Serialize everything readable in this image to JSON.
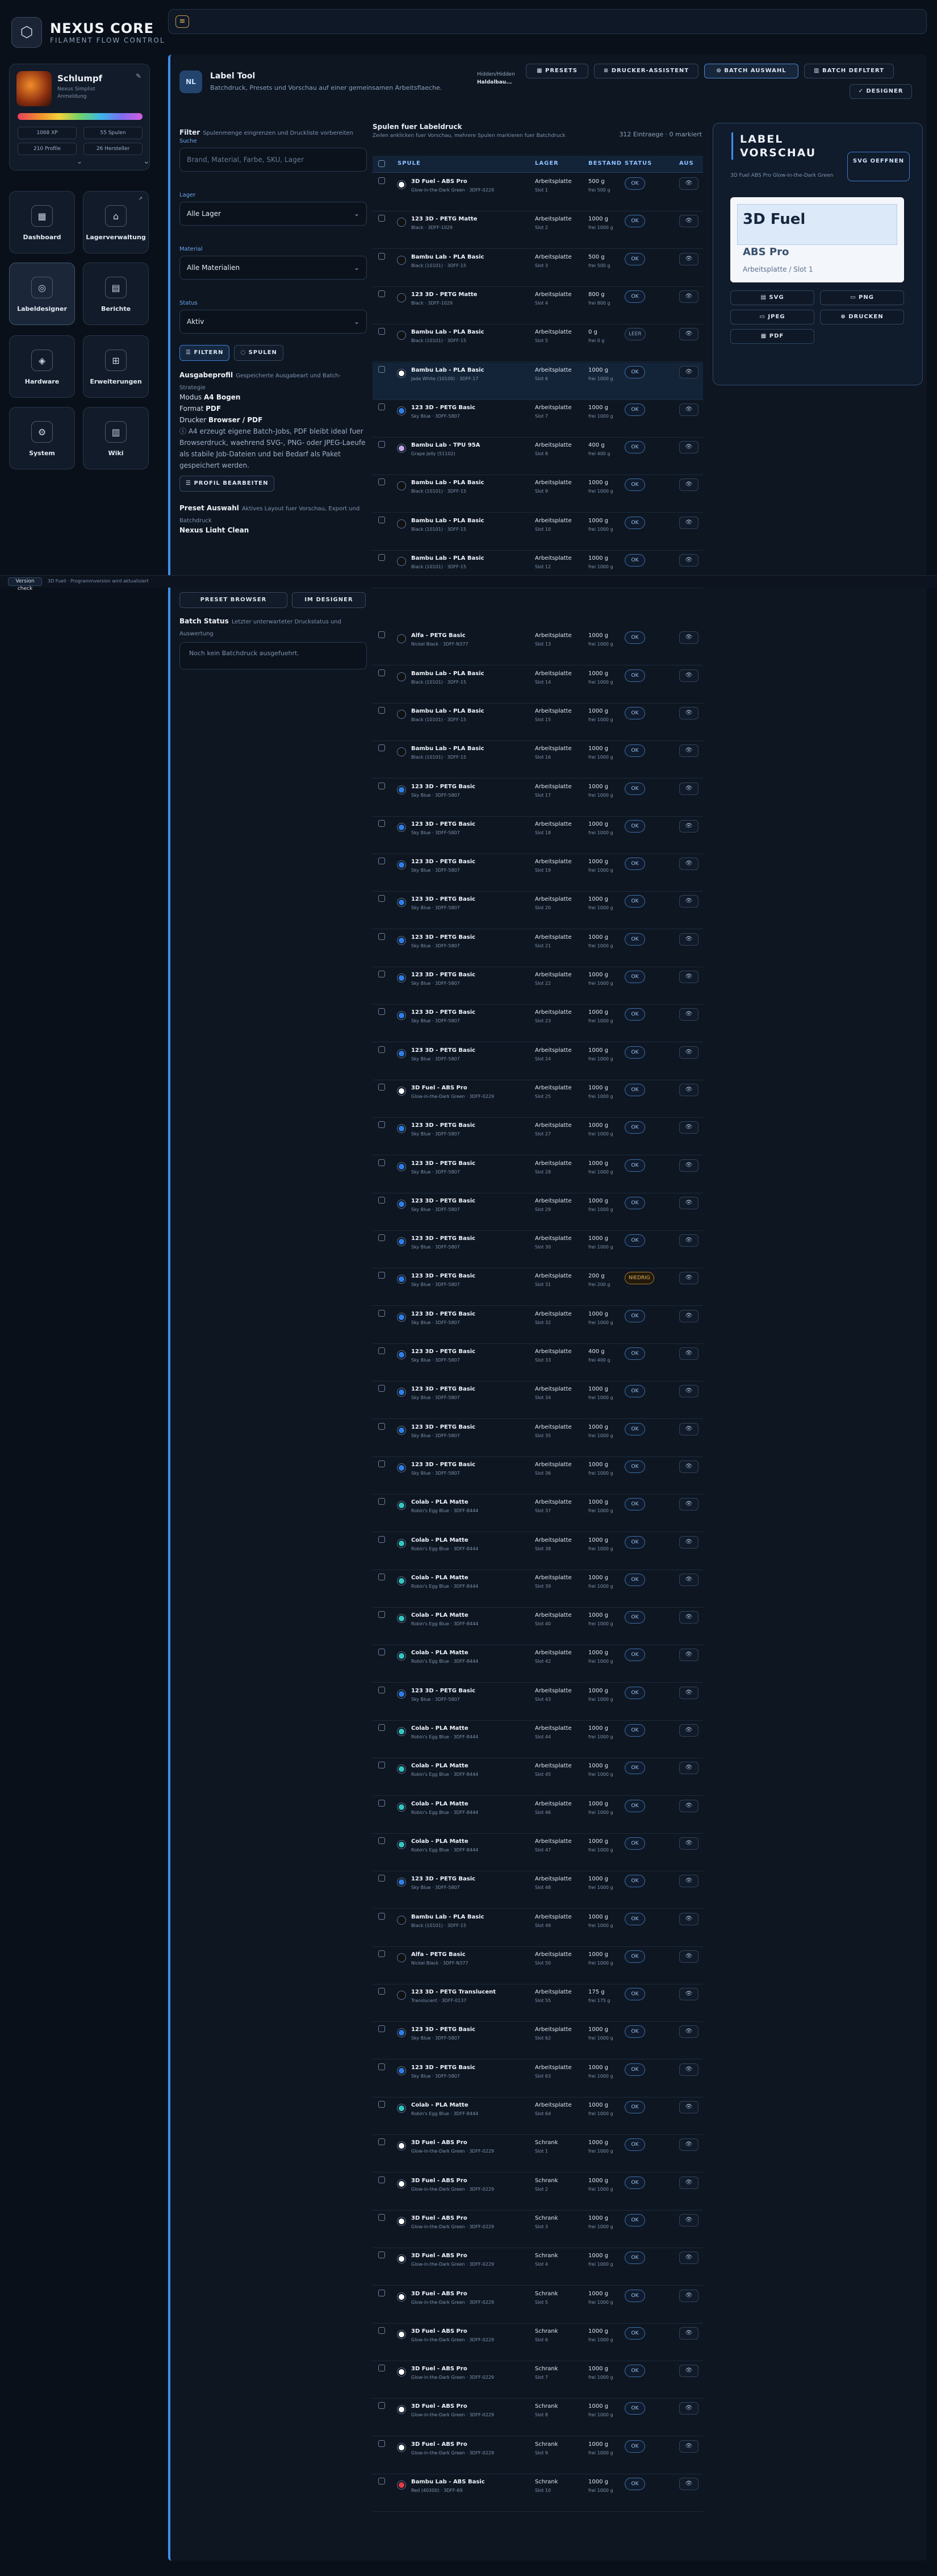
{
  "brand": {
    "title": "NEXUS CORE",
    "subtitle": "FILAMENT FLOW CONTROL"
  },
  "profile": {
    "name": "Schlumpf",
    "line1": "Nexus Simplist",
    "line2": "Anmeldung",
    "stats": [
      "1068 XP",
      "55 Spulen",
      "210 Profile",
      "26 Hersteller"
    ]
  },
  "nav": [
    {
      "label": "Dashboard",
      "icon": "grid-icon"
    },
    {
      "label": "Lagerverwaltung",
      "icon": "warehouse-icon"
    },
    {
      "label": "Labeldesigner",
      "icon": "tag-icon"
    },
    {
      "label": "Berichte",
      "icon": "report-icon"
    },
    {
      "label": "Hardware",
      "icon": "chip-icon"
    },
    {
      "label": "Erweiterungen",
      "icon": "plugin-icon"
    },
    {
      "label": "System",
      "icon": "gear-icon"
    },
    {
      "label": "Wiki",
      "icon": "book-icon"
    }
  ],
  "divider": {
    "button": "Version check",
    "text": "3D Fuell · Programmversion wird aktualisiert"
  },
  "tool": {
    "icon_text": "NL",
    "title": "Label Tool",
    "subtitle": "Batchdruck, Presets und Vorschau auf einer gemeinsamen Arbeitsflaeche.",
    "id_line1": "Hidden/Hidden",
    "id_line2": "Haldalbau..."
  },
  "toolbar": {
    "presets": "PRESETS",
    "printer": "DRUCKER-ASSISTENT",
    "batch": "BATCH AUSWAHL",
    "batch_off": "BATCH DEFLTERT",
    "designer": "DESIGNER"
  },
  "filter": {
    "title": "Filter",
    "desc": "Spulenmenge eingrenzen und Druckliste vorbereiten",
    "search_label": "Suche",
    "search_placeholder": "Brand, Material, Farbe, SKU, Lager",
    "lager_label": "Lager",
    "lager_value": "Alle Lager",
    "material_label": "Material",
    "material_value": "Alle Materialien",
    "status_label": "Status",
    "status_value": "Aktiv",
    "btn_filter": "FILTERN",
    "btn_reset": "SPULEN"
  },
  "output": {
    "title": "Ausgabeprofil",
    "desc": "Gespeicherte Ausgabeart und Batch-Strategie",
    "mode_label": "Modus",
    "mode_value": "A4 Bogen",
    "format_label": "Format",
    "format_value": "PDF",
    "printer_label": "Drucker",
    "printer_value": "Browser / PDF",
    "note": "A4 erzeugt eigene Batch-Jobs, PDF bleibt ideal fuer Browserdruck, waehrend SVG-, PNG- oder JPEG-Laeufe als stabile Job-Dateien und bei Bedarf als Paket gespeichert werden.",
    "edit_btn": "PROFIL BEARBEITEN"
  },
  "preset": {
    "title": "Preset Auswahl",
    "desc": "Aktives Layout fuer Vorschau, Export und Batchdruck",
    "current": "Nexus Light Clean",
    "browser_btn": "PRESET BROWSER",
    "designer_btn": "IM DESIGNER"
  },
  "batch": {
    "title": "Batch Status",
    "desc": "Letzter unterwarteter Druckstatus und Auswertung",
    "empty": "Noch kein Batchdruck ausgefuehrt."
  },
  "table": {
    "title": "Spulen fuer Labeldruck",
    "subtitle": "Zeilen anklicken fuer Vorschau, mehrere Spulen markieren fuer Batchdruck",
    "count": "312 Eintraege · 0 markiert",
    "headers": [
      "SPULE",
      "LAGER",
      "BESTAND",
      "STATUS",
      "AUS"
    ]
  },
  "rows": [
    {
      "name": "3D Fuel - ABS Pro",
      "sub": "Glow-in-the-Dark Green · 3DFF-0229",
      "lager": "Arbeitsplatte",
      "slot": "Slot 1",
      "amount": "500 g",
      "of": "frei 500 g",
      "status": "OK",
      "color": "#ffffff"
    },
    {
      "name": "123 3D - PETG Matte",
      "sub": "Black · 3DFF-1029",
      "lager": "Arbeitsplatte",
      "slot": "Slot 2",
      "amount": "1000 g",
      "of": "frei 1000 g",
      "status": "OK",
      "color": "#111111"
    },
    {
      "name": "Bambu Lab - PLA Basic",
      "sub": "Black (10101) · 3DFF-15",
      "lager": "Arbeitsplatte",
      "slot": "Slot 3",
      "amount": "500 g",
      "of": "frei 500 g",
      "status": "OK",
      "color": "#111111"
    },
    {
      "name": "123 3D - PETG Matte",
      "sub": "Black · 3DFF-1029",
      "lager": "Arbeitsplatte",
      "slot": "Slot 4",
      "amount": "800 g",
      "of": "frei 800 g",
      "status": "OK",
      "color": "#111111"
    },
    {
      "name": "Bambu Lab - PLA Basic",
      "sub": "Black (10101) · 3DFF-15",
      "lager": "Arbeitsplatte",
      "slot": "Slot 5",
      "amount": "0 g",
      "of": "frei 0 g",
      "status": "LEER",
      "color": "#111111"
    },
    {
      "name": "Bambu Lab - PLA Basic",
      "sub": "Jade White (10100) · 3DFF-17",
      "lager": "Arbeitsplatte",
      "slot": "Slot 6",
      "amount": "1000 g",
      "of": "frei 1000 g",
      "status": "OK",
      "color": "#ffffff",
      "selected": true
    },
    {
      "name": "123 3D - PETG Basic",
      "sub": "Sky Blue · 3DFF-5807",
      "lager": "Arbeitsplatte",
      "slot": "Slot 7",
      "amount": "1000 g",
      "of": "frei 1000 g",
      "status": "OK",
      "color": "#2f7fe8"
    },
    {
      "name": "Bambu Lab - TPU 95A",
      "sub": "Grape Jelly (51102)",
      "lager": "Arbeitsplatte",
      "slot": "Slot 8",
      "amount": "400 g",
      "of": "frei 400 g",
      "status": "OK",
      "color": "#c9a8e8"
    },
    {
      "name": "Bambu Lab - PLA Basic",
      "sub": "Black (10101) · 3DFF-15",
      "lager": "Arbeitsplatte",
      "slot": "Slot 9",
      "amount": "1000 g",
      "of": "frei 1000 g",
      "status": "OK",
      "color": "#111111"
    },
    {
      "name": "Bambu Lab - PLA Basic",
      "sub": "Black (10101) · 3DFF-15",
      "lager": "Arbeitsplatte",
      "slot": "Slot 10",
      "amount": "1000 g",
      "of": "frei 1000 g",
      "status": "OK",
      "color": "#111111"
    },
    {
      "name": "Bambu Lab - PLA Basic",
      "sub": "Black (10101) · 3DFF-15",
      "lager": "Arbeitsplatte",
      "slot": "Slot 12",
      "amount": "1000 g",
      "of": "frei 1000 g",
      "status": "OK",
      "color": "#111111"
    },
    {
      "name": "Alfa - PETG Basic",
      "sub": "Nickel Black · 3DFF-N377",
      "lager": "Arbeitsplatte",
      "slot": "Slot 13",
      "amount": "1000 g",
      "of": "frei 1000 g",
      "status": "OK",
      "color": "#111111"
    },
    {
      "name": "Bambu Lab - PLA Basic",
      "sub": "Black (10101) · 3DFF-15",
      "lager": "Arbeitsplatte",
      "slot": "Slot 14",
      "amount": "1000 g",
      "of": "frei 1000 g",
      "status": "OK",
      "color": "#111111"
    },
    {
      "name": "Bambu Lab - PLA Basic",
      "sub": "Black (10101) · 3DFF-15",
      "lager": "Arbeitsplatte",
      "slot": "Slot 15",
      "amount": "1000 g",
      "of": "frei 1000 g",
      "status": "OK",
      "color": "#111111"
    },
    {
      "name": "Bambu Lab - PLA Basic",
      "sub": "Black (10101) · 3DFF-15",
      "lager": "Arbeitsplatte",
      "slot": "Slot 16",
      "amount": "1000 g",
      "of": "frei 1000 g",
      "status": "OK",
      "color": "#111111"
    },
    {
      "name": "123 3D - PETG Basic",
      "sub": "Sky Blue · 3DFF-5807",
      "lager": "Arbeitsplatte",
      "slot": "Slot 17",
      "amount": "1000 g",
      "of": "frei 1000 g",
      "status": "OK",
      "color": "#2f7fe8"
    },
    {
      "name": "123 3D - PETG Basic",
      "sub": "Sky Blue · 3DFF-5807",
      "lager": "Arbeitsplatte",
      "slot": "Slot 18",
      "amount": "1000 g",
      "of": "frei 1000 g",
      "status": "OK",
      "color": "#2f7fe8"
    },
    {
      "name": "123 3D - PETG Basic",
      "sub": "Sky Blue · 3DFF-5807",
      "lager": "Arbeitsplatte",
      "slot": "Slot 19",
      "amount": "1000 g",
      "of": "frei 1000 g",
      "status": "OK",
      "color": "#2f7fe8"
    },
    {
      "name": "123 3D - PETG Basic",
      "sub": "Sky Blue · 3DFF-5807",
      "lager": "Arbeitsplatte",
      "slot": "Slot 20",
      "amount": "1000 g",
      "of": "frei 1000 g",
      "status": "OK",
      "color": "#2f7fe8"
    },
    {
      "name": "123 3D - PETG Basic",
      "sub": "Sky Blue · 3DFF-5807",
      "lager": "Arbeitsplatte",
      "slot": "Slot 21",
      "amount": "1000 g",
      "of": "frei 1000 g",
      "status": "OK",
      "color": "#2f7fe8"
    },
    {
      "name": "123 3D - PETG Basic",
      "sub": "Sky Blue · 3DFF-5807",
      "lager": "Arbeitsplatte",
      "slot": "Slot 22",
      "amount": "1000 g",
      "of": "frei 1000 g",
      "status": "OK",
      "color": "#2f7fe8"
    },
    {
      "name": "123 3D - PETG Basic",
      "sub": "Sky Blue · 3DFF-5807",
      "lager": "Arbeitsplatte",
      "slot": "Slot 23",
      "amount": "1000 g",
      "of": "frei 1000 g",
      "status": "OK",
      "color": "#2f7fe8"
    },
    {
      "name": "123 3D - PETG Basic",
      "sub": "Sky Blue · 3DFF-5807",
      "lager": "Arbeitsplatte",
      "slot": "Slot 24",
      "amount": "1000 g",
      "of": "frei 1000 g",
      "status": "OK",
      "color": "#2f7fe8"
    },
    {
      "name": "3D Fuel - ABS Pro",
      "sub": "Glow-in-the-Dark Green · 3DFF-0229",
      "lager": "Arbeitsplatte",
      "slot": "Slot 25",
      "amount": "1000 g",
      "of": "frei 1000 g",
      "status": "OK",
      "color": "#ffffff"
    },
    {
      "name": "123 3D - PETG Basic",
      "sub": "Sky Blue · 3DFF-5807",
      "lager": "Arbeitsplatte",
      "slot": "Slot 27",
      "amount": "1000 g",
      "of": "frei 1000 g",
      "status": "OK",
      "color": "#2f7fe8"
    },
    {
      "name": "123 3D - PETG Basic",
      "sub": "Sky Blue · 3DFF-5807",
      "lager": "Arbeitsplatte",
      "slot": "Slot 28",
      "amount": "1000 g",
      "of": "frei 1000 g",
      "status": "OK",
      "color": "#2f7fe8"
    },
    {
      "name": "123 3D - PETG Basic",
      "sub": "Sky Blue · 3DFF-5807",
      "lager": "Arbeitsplatte",
      "slot": "Slot 29",
      "amount": "1000 g",
      "of": "frei 1000 g",
      "status": "OK",
      "color": "#2f7fe8"
    },
    {
      "name": "123 3D - PETG Basic",
      "sub": "Sky Blue · 3DFF-5807",
      "lager": "Arbeitsplatte",
      "slot": "Slot 30",
      "amount": "1000 g",
      "of": "frei 1000 g",
      "status": "OK",
      "color": "#2f7fe8"
    },
    {
      "name": "123 3D - PETG Basic",
      "sub": "Sky Blue · 3DFF-5807",
      "lager": "Arbeitsplatte",
      "slot": "Slot 31",
      "amount": "200 g",
      "of": "frei 200 g",
      "status": "NIEDRIG",
      "color": "#2f7fe8"
    },
    {
      "name": "123 3D - PETG Basic",
      "sub": "Sky Blue · 3DFF-5807",
      "lager": "Arbeitsplatte",
      "slot": "Slot 32",
      "amount": "1000 g",
      "of": "frei 1000 g",
      "status": "OK",
      "color": "#2f7fe8"
    },
    {
      "name": "123 3D - PETG Basic",
      "sub": "Sky Blue · 3DFF-5807",
      "lager": "Arbeitsplatte",
      "slot": "Slot 33",
      "amount": "400 g",
      "of": "frei 400 g",
      "status": "OK",
      "color": "#2f7fe8"
    },
    {
      "name": "123 3D - PETG Basic",
      "sub": "Sky Blue · 3DFF-5807",
      "lager": "Arbeitsplatte",
      "slot": "Slot 34",
      "amount": "1000 g",
      "of": "frei 1000 g",
      "status": "OK",
      "color": "#2f7fe8"
    },
    {
      "name": "123 3D - PETG Basic",
      "sub": "Sky Blue · 3DFF-5807",
      "lager": "Arbeitsplatte",
      "slot": "Slot 35",
      "amount": "1000 g",
      "of": "frei 1000 g",
      "status": "OK",
      "color": "#2f7fe8"
    },
    {
      "name": "123 3D - PETG Basic",
      "sub": "Sky Blue · 3DFF-5807",
      "lager": "Arbeitsplatte",
      "slot": "Slot 36",
      "amount": "1000 g",
      "of": "frei 1000 g",
      "status": "OK",
      "color": "#2f7fe8"
    },
    {
      "name": "Colab - PLA Matte",
      "sub": "Robin's Egg Blue · 3DFF-8444",
      "lager": "Arbeitsplatte",
      "slot": "Slot 37",
      "amount": "1000 g",
      "of": "frei 1000 g",
      "status": "OK",
      "color": "#34c7c0"
    },
    {
      "name": "Colab - PLA Matte",
      "sub": "Robin's Egg Blue · 3DFF-8444",
      "lager": "Arbeitsplatte",
      "slot": "Slot 38",
      "amount": "1000 g",
      "of": "frei 1000 g",
      "status": "OK",
      "color": "#34c7c0"
    },
    {
      "name": "Colab - PLA Matte",
      "sub": "Robin's Egg Blue · 3DFF-8444",
      "lager": "Arbeitsplatte",
      "slot": "Slot 39",
      "amount": "1000 g",
      "of": "frei 1000 g",
      "status": "OK",
      "color": "#34c7c0"
    },
    {
      "name": "Colab - PLA Matte",
      "sub": "Robin's Egg Blue · 3DFF-8444",
      "lager": "Arbeitsplatte",
      "slot": "Slot 40",
      "amount": "1000 g",
      "of": "frei 1000 g",
      "status": "OK",
      "color": "#34c7c0"
    },
    {
      "name": "Colab - PLA Matte",
      "sub": "Robin's Egg Blue · 3DFF-8444",
      "lager": "Arbeitsplatte",
      "slot": "Slot 42",
      "amount": "1000 g",
      "of": "frei 1000 g",
      "status": "OK",
      "color": "#34c7c0"
    },
    {
      "name": "123 3D - PETG Basic",
      "sub": "Sky Blue · 3DFF-5807",
      "lager": "Arbeitsplatte",
      "slot": "Slot 43",
      "amount": "1000 g",
      "of": "frei 1000 g",
      "status": "OK",
      "color": "#2f7fe8"
    },
    {
      "name": "Colab - PLA Matte",
      "sub": "Robin's Egg Blue · 3DFF-8444",
      "lager": "Arbeitsplatte",
      "slot": "Slot 44",
      "amount": "1000 g",
      "of": "frei 1000 g",
      "status": "OK",
      "color": "#34c7c0"
    },
    {
      "name": "Colab - PLA Matte",
      "sub": "Robin's Egg Blue · 3DFF-8444",
      "lager": "Arbeitsplatte",
      "slot": "Slot 45",
      "amount": "1000 g",
      "of": "frei 1000 g",
      "status": "OK",
      "color": "#34c7c0"
    },
    {
      "name": "Colab - PLA Matte",
      "sub": "Robin's Egg Blue · 3DFF-8444",
      "lager": "Arbeitsplatte",
      "slot": "Slot 46",
      "amount": "1000 g",
      "of": "frei 1000 g",
      "status": "OK",
      "color": "#34c7c0"
    },
    {
      "name": "Colab - PLA Matte",
      "sub": "Robin's Egg Blue · 3DFF-8444",
      "lager": "Arbeitsplatte",
      "slot": "Slot 47",
      "amount": "1000 g",
      "of": "frei 1000 g",
      "status": "OK",
      "color": "#34c7c0"
    },
    {
      "name": "123 3D - PETG Basic",
      "sub": "Sky Blue · 3DFF-5807",
      "lager": "Arbeitsplatte",
      "slot": "Slot 48",
      "amount": "1000 g",
      "of": "frei 1000 g",
      "status": "OK",
      "color": "#2f7fe8"
    },
    {
      "name": "Bambu Lab - PLA Basic",
      "sub": "Black (10101) · 3DFF-15",
      "lager": "Arbeitsplatte",
      "slot": "Slot 49",
      "amount": "1000 g",
      "of": "frei 1000 g",
      "status": "OK",
      "color": "#111111"
    },
    {
      "name": "Alfa - PETG Basic",
      "sub": "Nickel Black · 3DFF-N377",
      "lager": "Arbeitsplatte",
      "slot": "Slot 50",
      "amount": "1000 g",
      "of": "frei 1000 g",
      "status": "OK",
      "color": "#111111"
    },
    {
      "name": "123 3D - PETG Translucent",
      "sub": "Translucent · 3DFF-0137",
      "lager": "Arbeitsplatte",
      "slot": "Slot 55",
      "amount": "175 g",
      "of": "frei 175 g",
      "status": "OK",
      "color": "#111111"
    },
    {
      "name": "123 3D - PETG Basic",
      "sub": "Sky Blue · 3DFF-5807",
      "lager": "Arbeitsplatte",
      "slot": "Slot 62",
      "amount": "1000 g",
      "of": "frei 1000 g",
      "status": "OK",
      "color": "#2f7fe8"
    },
    {
      "name": "123 3D - PETG Basic",
      "sub": "Sky Blue · 3DFF-5807",
      "lager": "Arbeitsplatte",
      "slot": "Slot 63",
      "amount": "1000 g",
      "of": "frei 1000 g",
      "status": "OK",
      "color": "#2f7fe8"
    },
    {
      "name": "Colab - PLA Matte",
      "sub": "Robin's Egg Blue · 3DFF-8444",
      "lager": "Arbeitsplatte",
      "slot": "Slot 64",
      "amount": "1000 g",
      "of": "frei 1000 g",
      "status": "OK",
      "color": "#34c7c0"
    },
    {
      "name": "3D Fuel - ABS Pro",
      "sub": "Glow-in-the-Dark Green · 3DFF-0229",
      "lager": "Schrank",
      "slot": "Slot 1",
      "amount": "1000 g",
      "of": "frei 1000 g",
      "status": "OK",
      "color": "#ffffff"
    },
    {
      "name": "3D Fuel - ABS Pro",
      "sub": "Glow-in-the-Dark Green · 3DFF-0229",
      "lager": "Schrank",
      "slot": "Slot 2",
      "amount": "1000 g",
      "of": "frei 1000 g",
      "status": "OK",
      "color": "#ffffff"
    },
    {
      "name": "3D Fuel - ABS Pro",
      "sub": "Glow-in-the-Dark Green · 3DFF-0229",
      "lager": "Schrank",
      "slot": "Slot 3",
      "amount": "1000 g",
      "of": "frei 1000 g",
      "status": "OK",
      "color": "#ffffff"
    },
    {
      "name": "3D Fuel - ABS Pro",
      "sub": "Glow-in-the-Dark Green · 3DFF-0229",
      "lager": "Schrank",
      "slot": "Slot 4",
      "amount": "1000 g",
      "of": "frei 1000 g",
      "status": "OK",
      "color": "#ffffff"
    },
    {
      "name": "3D Fuel - ABS Pro",
      "sub": "Glow-in-the-Dark Green · 3DFF-0229",
      "lager": "Schrank",
      "slot": "Slot 5",
      "amount": "1000 g",
      "of": "frei 1000 g",
      "status": "OK",
      "color": "#ffffff"
    },
    {
      "name": "3D Fuel - ABS Pro",
      "sub": "Glow-in-the-Dark Green · 3DFF-0229",
      "lager": "Schrank",
      "slot": "Slot 6",
      "amount": "1000 g",
      "of": "frei 1000 g",
      "status": "OK",
      "color": "#ffffff"
    },
    {
      "name": "3D Fuel - ABS Pro",
      "sub": "Glow-in-the-Dark Green · 3DFF-0229",
      "lager": "Schrank",
      "slot": "Slot 7",
      "amount": "1000 g",
      "of": "frei 1000 g",
      "status": "OK",
      "color": "#ffffff"
    },
    {
      "name": "3D Fuel - ABS Pro",
      "sub": "Glow-in-the-Dark Green · 3DFF-0229",
      "lager": "Schrank",
      "slot": "Slot 8",
      "amount": "1000 g",
      "of": "frei 1000 g",
      "status": "OK",
      "color": "#ffffff"
    },
    {
      "name": "3D Fuel - ABS Pro",
      "sub": "Glow-in-the-Dark Green · 3DFF-0229",
      "lager": "Schrank",
      "slot": "Slot 9",
      "amount": "1000 g",
      "of": "frei 1000 g",
      "status": "OK",
      "color": "#ffffff"
    },
    {
      "name": "Bambu Lab - ABS Basic",
      "sub": "Red (40300) · 3DFF-69",
      "lager": "Schrank",
      "slot": "Slot 10",
      "amount": "1000 g",
      "of": "frei 1000 g",
      "status": "OK",
      "color": "#e63a4a"
    }
  ],
  "preview": {
    "title": "LABEL VORSCHAU",
    "subtitle": "3D Fuel ABS Pro Glow-in-the-Dark Green",
    "svg_btn": "SVG OEFFNEN",
    "card_brand": "3D Fuel",
    "card_material": "ABS Pro",
    "card_location": "Arbeitsplatte / Slot 1",
    "btn_svg": "SVG",
    "btn_png": "PNG",
    "btn_jpeg": "JPEG",
    "btn_print": "DRUCKEN",
    "btn_pdf": "PDF"
  }
}
